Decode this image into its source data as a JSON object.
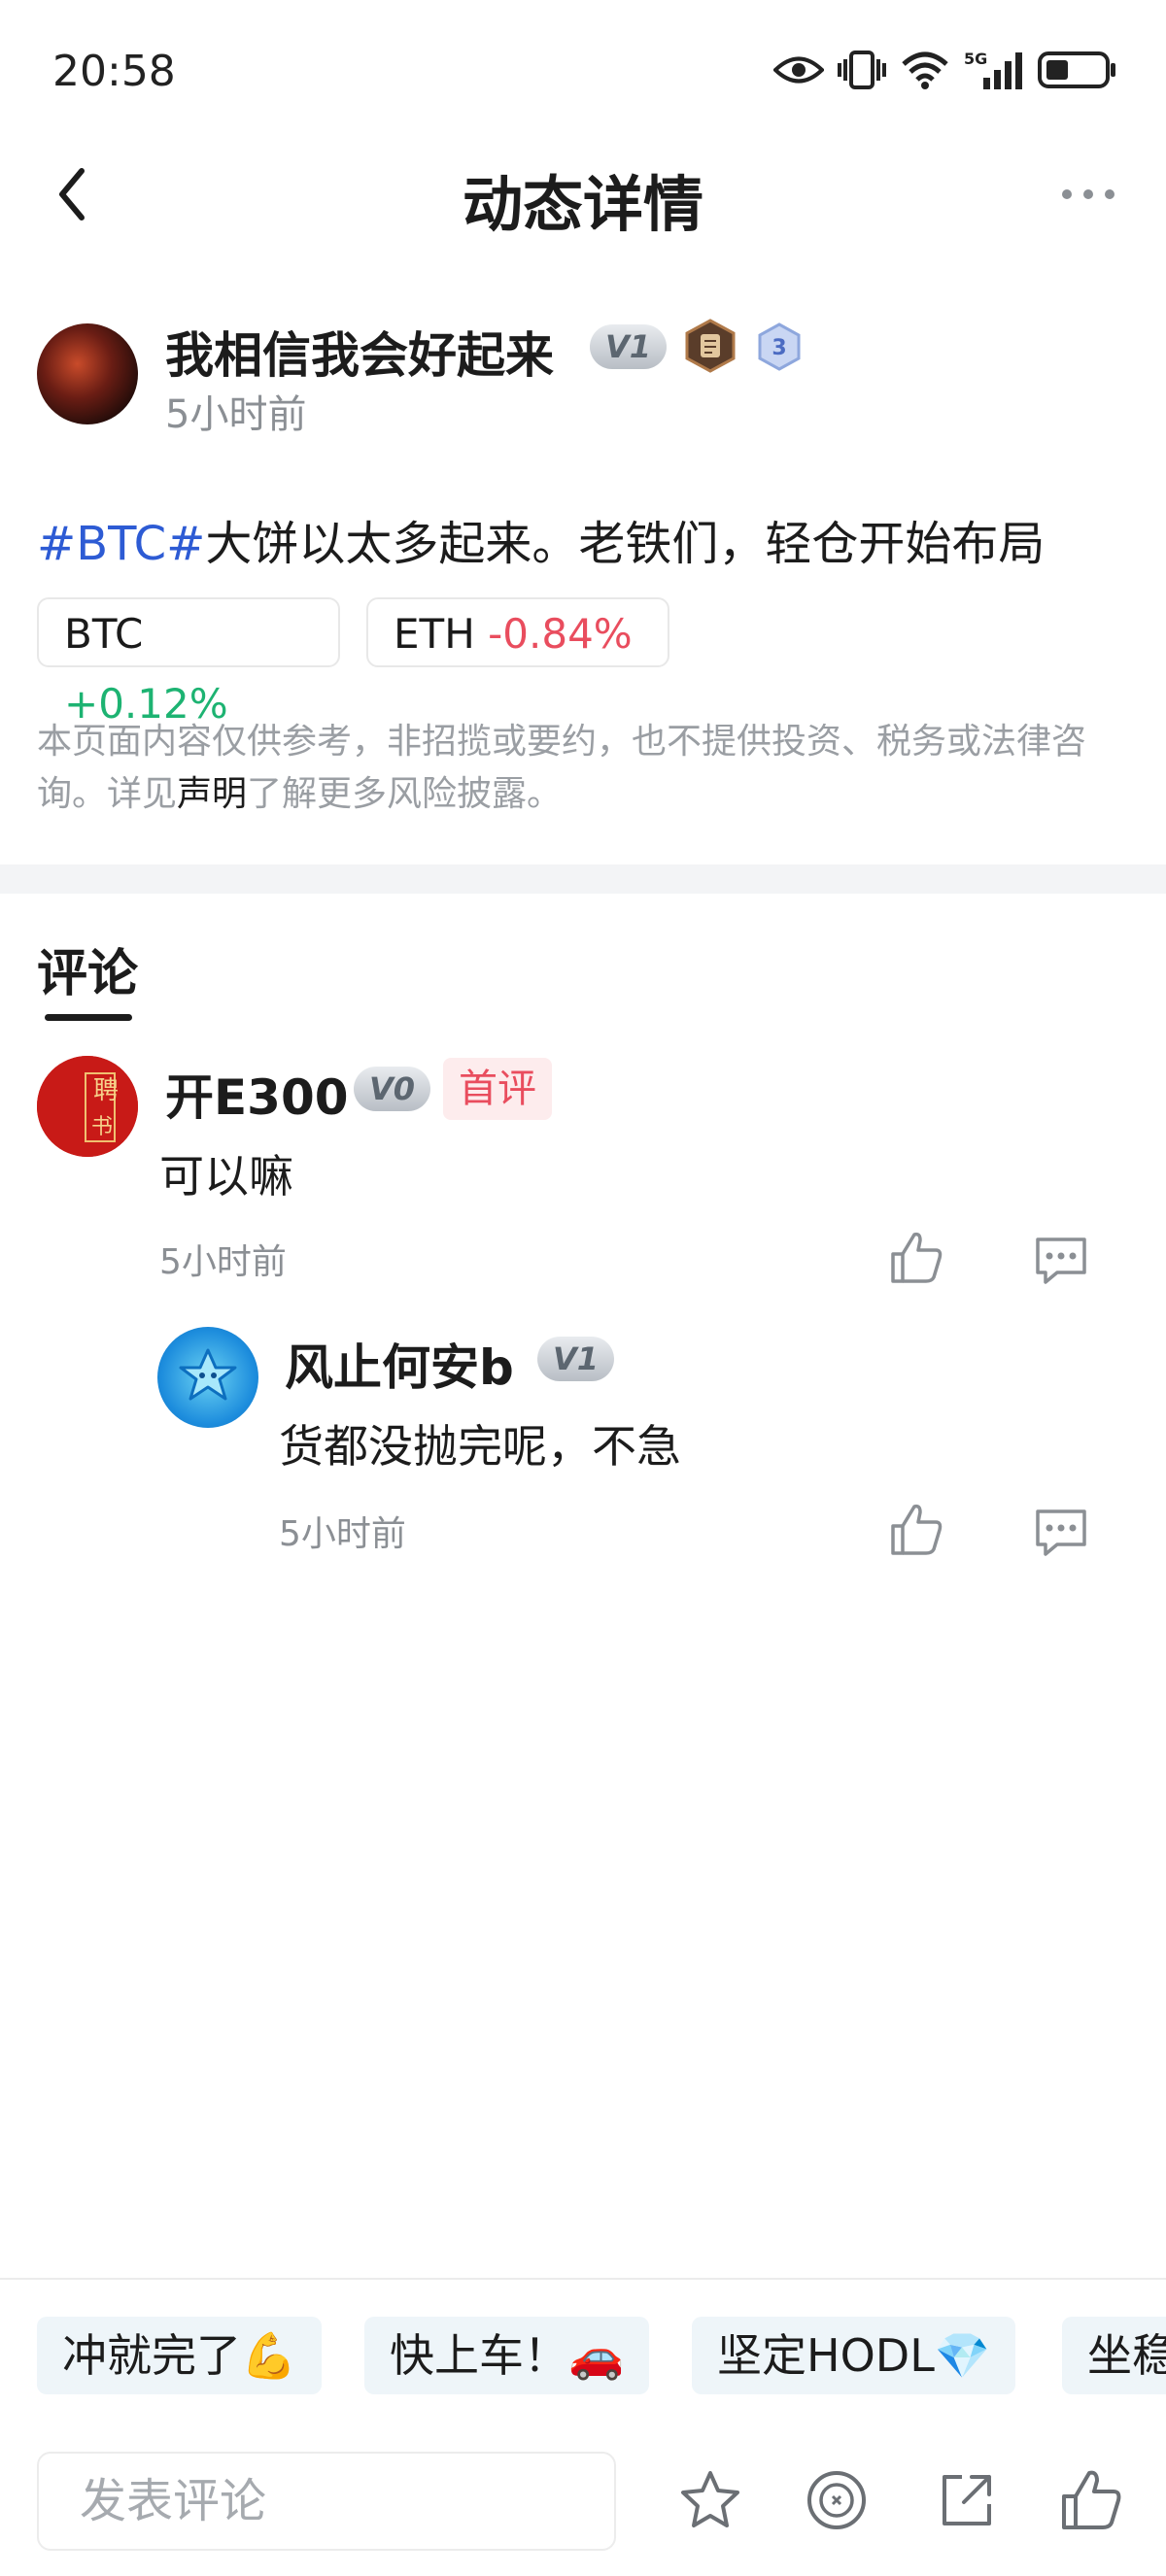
{
  "status_bar": {
    "time": "20:58",
    "icons": [
      "eye-icon",
      "vibrate-icon",
      "wifi-icon",
      "signal-5g-icon",
      "battery-icon"
    ]
  },
  "nav": {
    "title": "动态详情",
    "back_icon": "chevron-left-icon",
    "more_icon": "more-dots-icon"
  },
  "post": {
    "username": "我相信我会好起来",
    "level_badge": "V1",
    "medal_number": "3",
    "time": "5小时前",
    "hashtag": "#BTC#",
    "text": "大饼以太多起来。老铁们，轻仓开始布局",
    "coins": [
      {
        "symbol": "BTC",
        "change": "+0.12%",
        "direction": "up"
      },
      {
        "symbol": "ETH",
        "change": "-0.84%",
        "direction": "down"
      }
    ],
    "disclaimer_before": "本页面内容仅供参考，非招揽或要约，也不提供投资、税务或法律咨询。详见",
    "disclaimer_link": "声明",
    "disclaimer_after": "了解更多风险披露。"
  },
  "comments": {
    "heading": "评论",
    "items": [
      {
        "username": "开E300",
        "level_badge": "V0",
        "tag": "首评",
        "avatar_text_1": "聘",
        "avatar_text_2": "书",
        "text": "可以嘛",
        "time": "5小时前",
        "replies": [
          {
            "username": "风止何安b",
            "level_badge": "V1",
            "text": "货都没抛完呢，不急",
            "time": "5小时前"
          }
        ]
      }
    ]
  },
  "quick_replies": [
    "冲就完了💪",
    "快上车！🚗",
    "坚定HODL💎",
    "坐稳"
  ],
  "comment_input": {
    "placeholder": "发表评论"
  },
  "toolbar_icons": [
    "star-icon",
    "coin-icon",
    "share-icon",
    "thumbs-up-icon"
  ],
  "colors": {
    "hashtag": "#2d5bd4",
    "positive": "#1db372",
    "negative": "#e94d5e"
  }
}
